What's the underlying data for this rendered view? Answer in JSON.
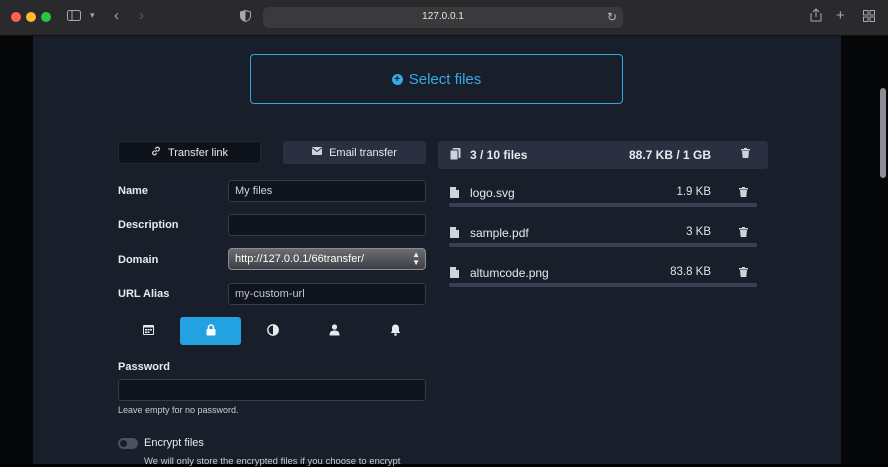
{
  "browser": {
    "url": "127.0.0.1"
  },
  "upload": {
    "select_files_label": "Select files"
  },
  "tabs": [
    {
      "label": "Transfer link"
    },
    {
      "label": "Email transfer"
    }
  ],
  "form": {
    "name_label": "Name",
    "name_value": "My files",
    "description_label": "Description",
    "description_value": "",
    "domain_label": "Domain",
    "domain_value": "http://127.0.0.1/66transfer/",
    "url_alias_label": "URL Alias",
    "url_alias_placeholder": "my-custom-url",
    "password_label": "Password",
    "password_hint": "Leave empty for no password.",
    "encrypt_label": "Encrypt files",
    "encrypt_note": "We will only store the encrypted files if you choose to encrypt"
  },
  "options_toolbar": {
    "icons": [
      "calendar-icon",
      "lock-icon",
      "contrast-icon",
      "user-icon",
      "bell-icon"
    ],
    "active_index": 1
  },
  "files_panel": {
    "count_text": "3 / 10 files",
    "size_text": "88.7 KB / 1 GB",
    "files": [
      {
        "name": "logo.svg",
        "size": "1.9 KB"
      },
      {
        "name": "sample.pdf",
        "size": "3 KB"
      },
      {
        "name": "altumcode.png",
        "size": "83.8 KB"
      }
    ]
  },
  "colors": {
    "accent": "#23a2e2",
    "page_bg": "#191e2b"
  }
}
